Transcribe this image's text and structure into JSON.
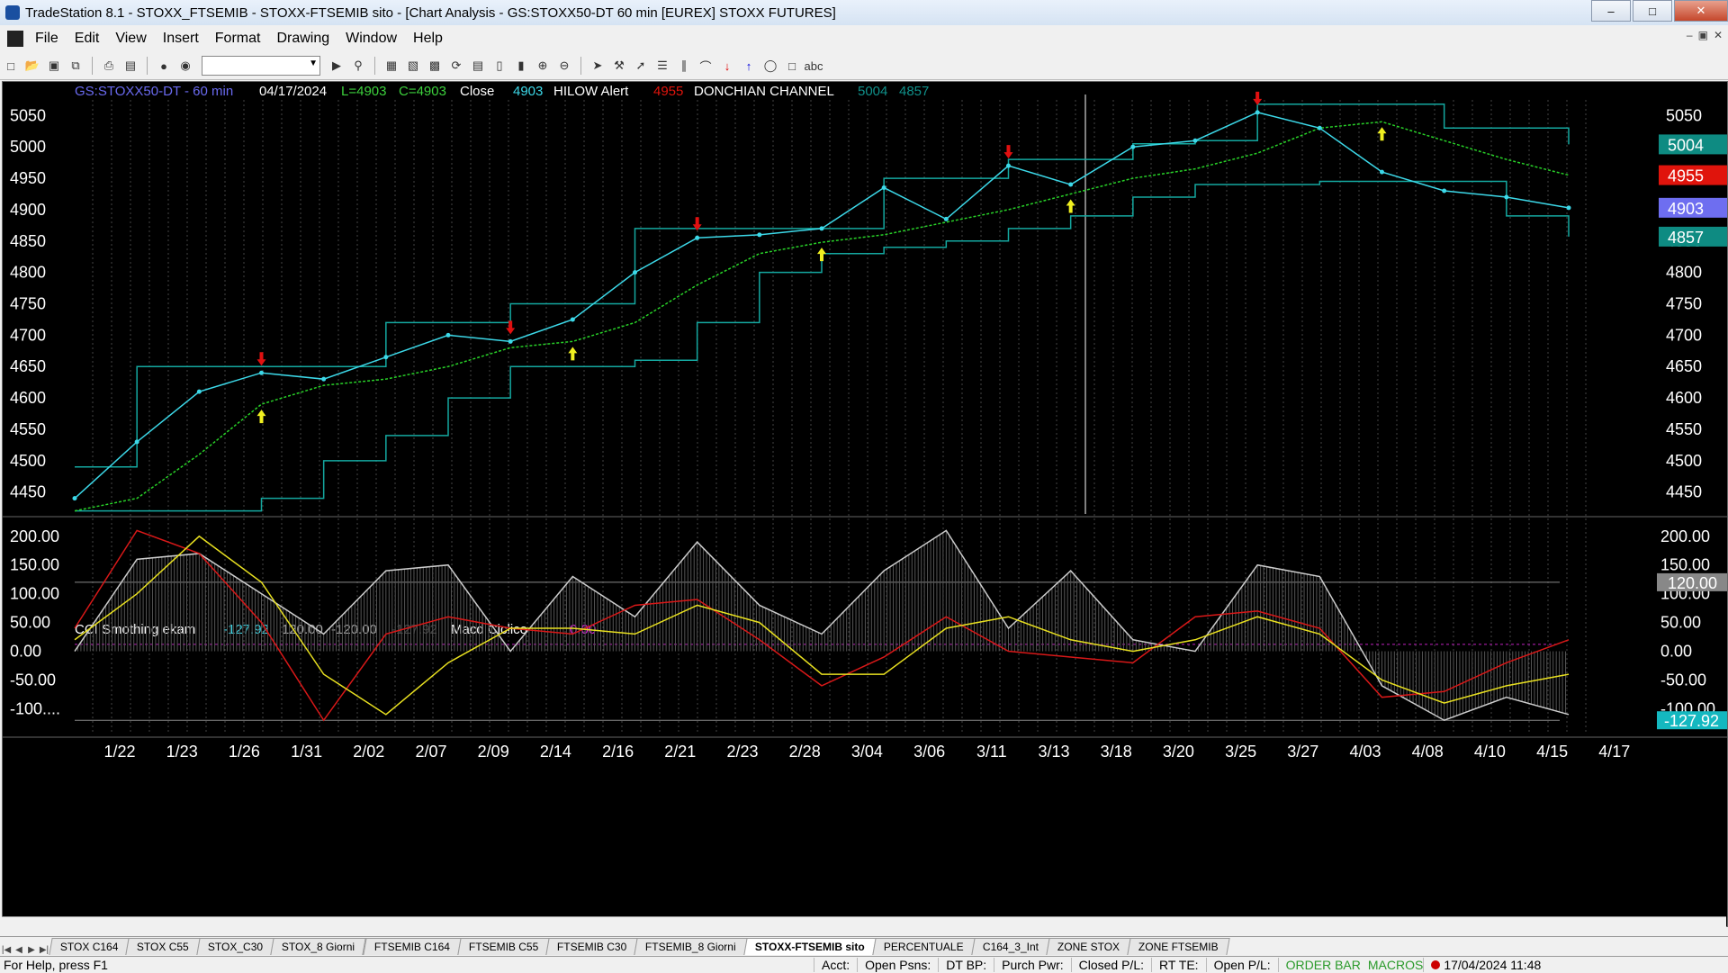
{
  "window": {
    "title": "TradeStation 8.1 - STOXX_FTSEMIB - STOXX-FTSEMIB sito - [Chart Analysis - GS:STOXX50-DT  60 min  [EUREX] STOXX FUTURES]",
    "min_label": "–",
    "max_label": "□",
    "close_label": "✕"
  },
  "menu": [
    "File",
    "Edit",
    "View",
    "Insert",
    "Format",
    "Drawing",
    "Window",
    "Help"
  ],
  "mdi_controls": [
    "–",
    "▣",
    "✕"
  ],
  "toolbar_icons": [
    "new-icon",
    "open-icon",
    "save-icon",
    "print-icon",
    "copy-icon",
    "zoom-in-icon",
    "zoom-out-icon",
    "cursor-icon",
    "trendline-icon",
    "fib-icon",
    "arrow-up-icon",
    "arrow-down-icon",
    "ellipse-icon",
    "rectangle-icon",
    "text-icon"
  ],
  "chart_header": {
    "symbol": "GS:STOXX50-DT - 60 min",
    "date": "04/17/2024",
    "low": "L=4903",
    "close": "C=4903",
    "close_label": "Close",
    "close_value": "4903",
    "hilow": "HILOW Alert",
    "donchian_mid_value": "4955",
    "donchian_label": "DONCHIAN CHANNEL",
    "donchian_upper_value": "5004",
    "donchian_lower_value": "4857"
  },
  "indicator_header": {
    "name": "CCI Smothing ekam",
    "value": "-127.92",
    "upper_level": "120.00",
    "lower_level": "-120.00",
    "prev_value": "-127.92",
    "macd_name": "Macd Ciclico",
    "macd_value": "0.00"
  },
  "price_axis": {
    "ticks": [
      "5050",
      "5000",
      "4950",
      "4900",
      "4850",
      "4800",
      "4750",
      "4700",
      "4650",
      "4600",
      "4550",
      "4500",
      "4450"
    ],
    "ylim": [
      4418,
      5072
    ],
    "right_badges": [
      {
        "value": "5004",
        "color": "#0e8b82"
      },
      {
        "value": "4955",
        "color": "#e0140c"
      },
      {
        "value": "4903",
        "color": "#6e6ef0"
      },
      {
        "value": "4857",
        "color": "#0e8b82"
      }
    ]
  },
  "osc_axis": {
    "ticks": [
      "200.00",
      "150.00",
      "100.00",
      "50.00",
      "0.00",
      "-50.00",
      "-100...."
    ],
    "right_ticks": [
      "200.00",
      "150.00",
      "100.00",
      "50.00",
      "0.00",
      "-50.00",
      "-100.00"
    ],
    "ylim": [
      -140,
      220
    ],
    "badge_120": "120.00",
    "badge_value": "-127.92"
  },
  "date_axis": [
    "1/22",
    "1/23",
    "1/26",
    "1/31",
    "2/02",
    "2/07",
    "2/09",
    "2/14",
    "2/16",
    "2/21",
    "2/23",
    "2/28",
    "3/04",
    "3/06",
    "3/11",
    "3/13",
    "3/18",
    "3/20",
    "3/25",
    "3/27",
    "4/03",
    "4/08",
    "4/10",
    "4/15",
    "4/17"
  ],
  "chart_data": {
    "type": "line",
    "price_series": {
      "name": "Close",
      "x": [
        "1/22",
        "1/23",
        "1/26",
        "1/31",
        "2/02",
        "2/07",
        "2/09",
        "2/14",
        "2/16",
        "2/21",
        "2/23",
        "2/28",
        "3/04",
        "3/06",
        "3/11",
        "3/13",
        "3/18",
        "3/20",
        "3/25",
        "3/27",
        "4/03",
        "4/08",
        "4/10",
        "4/15",
        "4/17"
      ],
      "values": [
        4440,
        4530,
        4610,
        4640,
        4630,
        4665,
        4700,
        4690,
        4725,
        4800,
        4855,
        4860,
        4870,
        4935,
        4885,
        4970,
        4940,
        5000,
        5010,
        5055,
        5030,
        4960,
        4930,
        4920,
        4903
      ]
    },
    "ma_series": {
      "x": [
        "1/22",
        "1/23",
        "1/26",
        "1/31",
        "2/02",
        "2/07",
        "2/09",
        "2/14",
        "2/16",
        "2/21",
        "2/23",
        "2/28",
        "3/04",
        "3/06",
        "3/11",
        "3/13",
        "3/18",
        "3/20",
        "3/25",
        "3/27",
        "4/03",
        "4/08",
        "4/10",
        "4/15",
        "4/17"
      ],
      "values": [
        4420,
        4440,
        4510,
        4590,
        4620,
        4630,
        4650,
        4680,
        4690,
        4720,
        4780,
        4830,
        4848,
        4860,
        4880,
        4900,
        4925,
        4950,
        4965,
        4990,
        5030,
        5040,
        5010,
        4980,
        4955
      ]
    },
    "donchian_upper": [
      4490,
      4650,
      4650,
      4650,
      4650,
      4720,
      4720,
      4750,
      4750,
      4870,
      4870,
      4870,
      4870,
      4950,
      4950,
      4980,
      4980,
      5005,
      5010,
      5068,
      5068,
      5068,
      5030,
      5030,
      5004
    ],
    "donchian_lower": [
      4420,
      4420,
      4420,
      4440,
      4500,
      4540,
      4600,
      4650,
      4650,
      4660,
      4720,
      4800,
      4830,
      4840,
      4850,
      4870,
      4890,
      4920,
      4940,
      4940,
      4945,
      4945,
      4945,
      4890,
      4857
    ],
    "sell_arrows": [
      "1/31",
      "2/14",
      "2/23",
      "3/13",
      "3/27"
    ],
    "buy_arrows": [
      "1/31",
      "2/16",
      "3/04",
      "3/18",
      "4/08"
    ],
    "osc_red": [
      40,
      210,
      170,
      50,
      -120,
      30,
      60,
      40,
      30,
      80,
      90,
      20,
      -60,
      -10,
      60,
      0,
      -10,
      -20,
      60,
      70,
      40,
      -80,
      -70,
      -20,
      20
    ],
    "osc_yellow": [
      20,
      100,
      200,
      120,
      -40,
      -110,
      -20,
      40,
      40,
      30,
      80,
      50,
      -40,
      -40,
      40,
      60,
      20,
      0,
      20,
      60,
      30,
      -50,
      -90,
      -60,
      -40
    ],
    "osc_hist": [
      0,
      160,
      170,
      100,
      30,
      140,
      150,
      0,
      130,
      60,
      190,
      80,
      30,
      140,
      210,
      40,
      140,
      20,
      0,
      150,
      130,
      -60,
      -120,
      -80,
      -110
    ]
  },
  "tabs": [
    "STOX C164",
    "STOX C55",
    "STOX_C30",
    "STOX_8 Giorni",
    "FTSEMIB C164",
    "FTSEMIB C55",
    "FTSEMIB C30",
    "FTSEMIB_8 Giorni",
    "STOXX-FTSEMIB sito",
    "PERCENTUALE",
    "C164_3_Int",
    "ZONE STOX",
    "ZONE FTSEMIB"
  ],
  "active_tab": "STOXX-FTSEMIB sito",
  "status": {
    "help": "For Help, press F1",
    "acct": "Acct:",
    "open_psns": "Open Psns:",
    "dt_bp": "DT BP:",
    "purch_pwr": "Purch Pwr:",
    "closed_pl": "Closed P/L:",
    "rt_te": "RT TE:",
    "open_pl": "Open P/L:",
    "order_bar": "ORDER BAR",
    "macros": "MACROS",
    "datetime": "17/04/2024 11:48"
  }
}
